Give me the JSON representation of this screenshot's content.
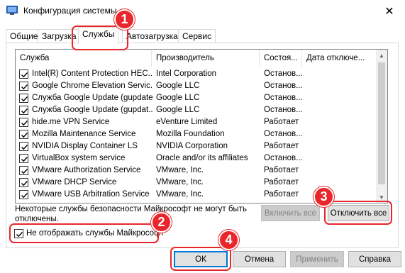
{
  "window": {
    "title": "Конфигурация системы",
    "close_glyph": "✕"
  },
  "tabs": [
    "Общие",
    "Загрузка",
    "Службы",
    "Автозагрузка",
    "Сервис"
  ],
  "active_tab": "Службы",
  "services_table": {
    "columns": [
      "Служба",
      "Производитель",
      "Состоя...",
      "Дата отключе..."
    ],
    "rows": [
      {
        "checked": true,
        "name": "Intel(R) Content Protection HEC...",
        "vendor": "Intel Corporation",
        "status": "Останов..."
      },
      {
        "checked": true,
        "name": "Google Chrome Elevation Servic...",
        "vendor": "Google LLC",
        "status": "Останов..."
      },
      {
        "checked": true,
        "name": "Служба Google Update (gupdate)",
        "vendor": "Google LLC",
        "status": "Останов..."
      },
      {
        "checked": true,
        "name": "Служба Google Update (gupdat...",
        "vendor": "Google LLC",
        "status": "Останов..."
      },
      {
        "checked": true,
        "name": "hide.me VPN Service",
        "vendor": "eVenture Limited",
        "status": "Работает"
      },
      {
        "checked": true,
        "name": "Mozilla Maintenance Service",
        "vendor": "Mozilla Foundation",
        "status": "Останов..."
      },
      {
        "checked": true,
        "name": "NVIDIA Display Container LS",
        "vendor": "NVIDIA Corporation",
        "status": "Работает"
      },
      {
        "checked": true,
        "name": "VirtualBox system service",
        "vendor": "Oracle and/or its affiliates",
        "status": "Останов..."
      },
      {
        "checked": true,
        "name": "VMware Authorization Service",
        "vendor": "VMware, Inc.",
        "status": "Работает"
      },
      {
        "checked": true,
        "name": "VMware DHCP Service",
        "vendor": "VMware, Inc.",
        "status": "Работает"
      },
      {
        "checked": true,
        "name": "VMware USB Arbitration Service",
        "vendor": "VMware, Inc.",
        "status": "Работает"
      }
    ]
  },
  "note": "Некоторые службы безопасности Майкрософт не могут быть отключены.",
  "buttons": {
    "enable_all": "Включить все",
    "disable_all": "Отключить все",
    "ok": "ОК",
    "cancel": "Отмена",
    "apply": "Применить",
    "help": "Справка"
  },
  "hide_ms_services": {
    "label": "Не отображать службы Майкрософт",
    "checked": true
  },
  "annotations": [
    "1",
    "2",
    "3",
    "4"
  ],
  "colors": {
    "annotation": "#e8262c",
    "default_button_border": "#0078d7"
  }
}
